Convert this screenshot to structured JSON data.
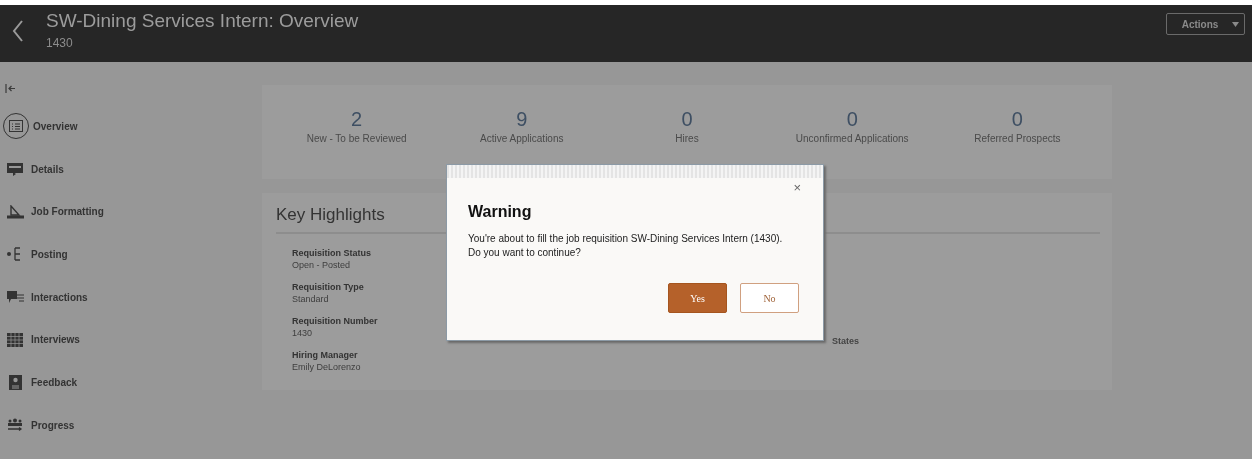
{
  "header": {
    "title": "SW-Dining Services Intern: Overview",
    "subtitle": "1430",
    "actions_button": "Actions"
  },
  "sidebar": {
    "items": [
      {
        "label": "Overview",
        "selected": true
      },
      {
        "label": "Details",
        "selected": false
      },
      {
        "label": "Job Formatting",
        "selected": false
      },
      {
        "label": "Posting",
        "selected": false
      },
      {
        "label": "Interactions",
        "selected": false
      },
      {
        "label": "Interviews",
        "selected": false
      },
      {
        "label": "Feedback",
        "selected": false
      },
      {
        "label": "Progress",
        "selected": false
      }
    ]
  },
  "metrics": [
    {
      "value": "2",
      "label": "New - To be Reviewed"
    },
    {
      "value": "9",
      "label": "Active Applications"
    },
    {
      "value": "0",
      "label": "Hires"
    },
    {
      "value": "0",
      "label": "Unconfirmed Applications"
    },
    {
      "value": "0",
      "label": "Referred Prospects"
    }
  ],
  "key_highlights": {
    "title": "Key Highlights",
    "fields": [
      {
        "label": "Requisition Status",
        "value": "Open - Posted"
      },
      {
        "label": "Requisition Type",
        "value": "Standard"
      },
      {
        "label": "Requisition Number",
        "value": "1430"
      },
      {
        "label": "Hiring Manager",
        "value": "Emily DeLorenzo"
      }
    ],
    "column_2_fragment": "States"
  },
  "dialog": {
    "title": "Warning",
    "message": "You're about to fill the job requisition SW-Dining Services Intern (1430). Do you want to continue?",
    "close": "×",
    "buttons": [
      {
        "label": "Yes",
        "kind": "primary"
      },
      {
        "label": "No",
        "kind": "secondary"
      }
    ]
  }
}
